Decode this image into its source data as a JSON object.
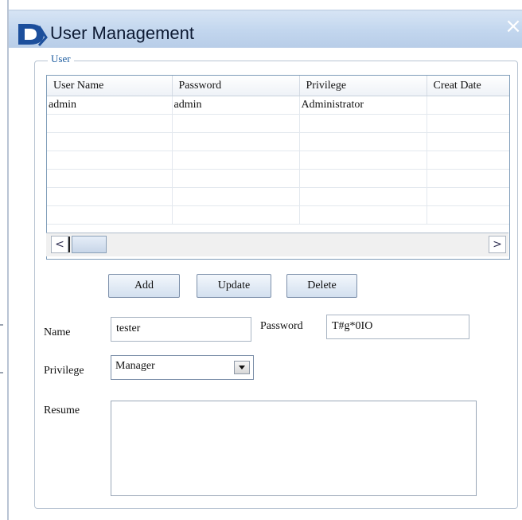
{
  "window": {
    "title": "User Management",
    "close": "×"
  },
  "group": {
    "legend": "User"
  },
  "grid": {
    "columns": [
      "User Name",
      "Password",
      "Privilege",
      "Creat Date"
    ],
    "rows": [
      [
        "admin",
        "admin",
        "Administrator",
        ""
      ],
      [
        "",
        "",
        "",
        ""
      ],
      [
        "",
        "",
        "",
        ""
      ],
      [
        "",
        "",
        "",
        ""
      ],
      [
        "",
        "",
        "",
        ""
      ],
      [
        "",
        "",
        "",
        ""
      ],
      [
        "",
        "",
        "",
        ""
      ]
    ],
    "scroll_left": "<",
    "scroll_right": ">"
  },
  "buttons": {
    "add": "Add",
    "update": "Update",
    "delete": "Delete"
  },
  "form": {
    "name_label": "Name",
    "name_value": "tester",
    "password_label": "Password",
    "password_value": "T#g*0IO",
    "privilege_label": "Privilege",
    "privilege_value": "Manager",
    "resume_label": "Resume",
    "resume_value": ""
  },
  "colors": {
    "title_bar": "#c2d6ee",
    "legend": "#1a5a9e",
    "logo": "#1c4f9c"
  }
}
